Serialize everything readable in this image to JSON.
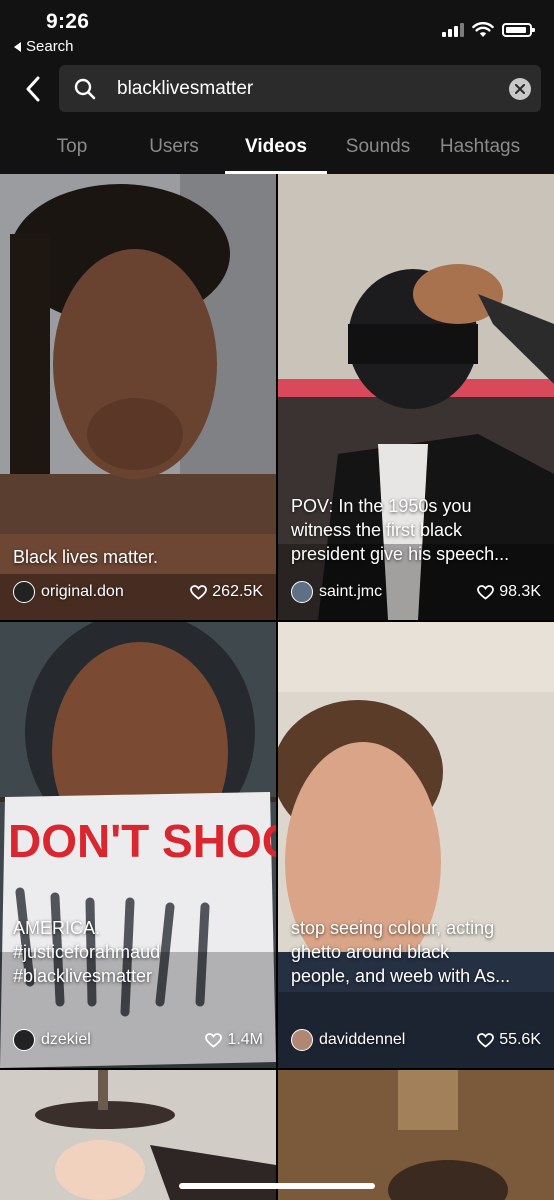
{
  "status_bar": {
    "time": "9:26",
    "back_app": "Search"
  },
  "search": {
    "query": "blacklivesmatter"
  },
  "tabs": [
    "Top",
    "Users",
    "Videos",
    "Sounds",
    "Hashtags"
  ],
  "active_tab": "Videos",
  "videos": [
    {
      "caption": "Black lives matter.",
      "username": "original.don",
      "likes": "262.5K"
    },
    {
      "caption": "POV: In the 1950s you\nwitness the first black\npresident give his speech...",
      "username": "saint.jmc",
      "likes": "98.3K"
    },
    {
      "caption": "AMERICA.\n#justiceforahmaud\n#blacklivesmatter",
      "username": "dzekiel",
      "likes": "1.4M"
    },
    {
      "caption": "stop seeing colour, acting\nghetto around black\npeople, and weeb with As...",
      "username": "daviddennel",
      "likes": "55.6K"
    }
  ],
  "colors": {
    "header_bg": "#121212",
    "search_bg": "#2b2b2b",
    "inactive_tab": "#8a8a8a",
    "active_tab": "#ffffff"
  }
}
